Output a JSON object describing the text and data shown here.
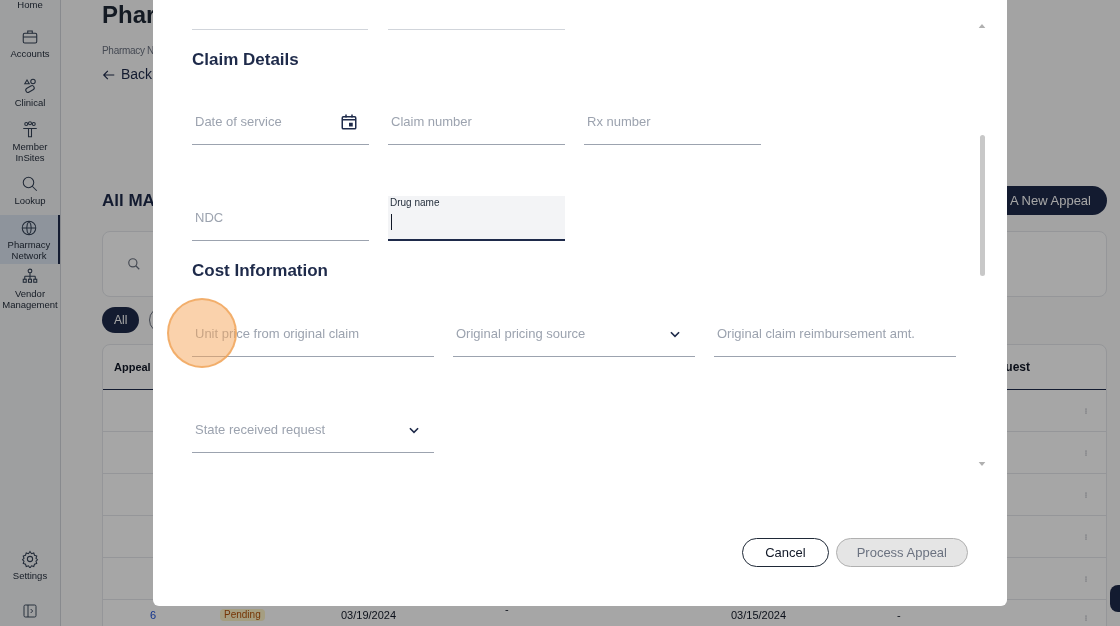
{
  "sidebar": {
    "items": [
      {
        "kind": "home",
        "label": "Home",
        "selected": false
      },
      {
        "kind": "accounts",
        "label": "Accounts",
        "selected": false
      },
      {
        "kind": "clinical",
        "label": "Clinical",
        "selected": false
      },
      {
        "kind": "member",
        "label": "Member InSites",
        "selected": false
      },
      {
        "kind": "lookup",
        "label": "Lookup",
        "selected": false
      },
      {
        "kind": "network",
        "label": "Pharmacy Network",
        "selected": true
      },
      {
        "kind": "vendor",
        "label": "Vendor Management",
        "selected": false
      }
    ],
    "settings": {
      "label": "Settings"
    }
  },
  "page": {
    "title": "Phar",
    "breadcrumb": "Pharmacy N",
    "back": "Back",
    "section_title": "All MA",
    "new_appeal_button": "A New Appeal",
    "filter_chips": [
      {
        "label": "All",
        "selected": true
      }
    ],
    "table": {
      "columns": [
        "Appeal",
        "uest"
      ],
      "rows": [
        {
          "menu": true
        },
        {
          "menu": true
        },
        {
          "menu": true
        },
        {
          "menu": true
        },
        {
          "menu": true
        },
        {
          "menu": true,
          "cells": [
            "6",
            "Pending",
            "03/19/2024",
            "-",
            "03/15/2024",
            "-"
          ]
        }
      ]
    }
  },
  "dialog": {
    "sections": [
      {
        "title": "Claim Details",
        "rows": [
          [
            {
              "kind": "date",
              "placeholder": "Date of service",
              "focused": false
            },
            {
              "kind": "text",
              "placeholder": "Claim number",
              "focused": false
            },
            {
              "kind": "text",
              "placeholder": "Rx number",
              "focused": false
            }
          ],
          [
            {
              "kind": "text",
              "placeholder": "NDC",
              "focused": false
            },
            {
              "kind": "text",
              "label": "Drug name",
              "focused": true
            }
          ]
        ]
      },
      {
        "title": "Cost Information",
        "rows": [
          [
            {
              "kind": "text",
              "placeholder": "Unit price from original claim",
              "focused": false
            },
            {
              "kind": "select",
              "placeholder": "Original pricing source",
              "focused": false
            },
            {
              "kind": "text",
              "placeholder": "Original claim reimbursement amt.",
              "focused": false
            }
          ],
          [
            {
              "kind": "select",
              "placeholder": "State received request",
              "focused": false
            }
          ]
        ]
      }
    ],
    "buttons": [
      {
        "label": "Cancel",
        "disabled": false
      },
      {
        "label": "Process Appeal",
        "disabled": true
      }
    ]
  }
}
